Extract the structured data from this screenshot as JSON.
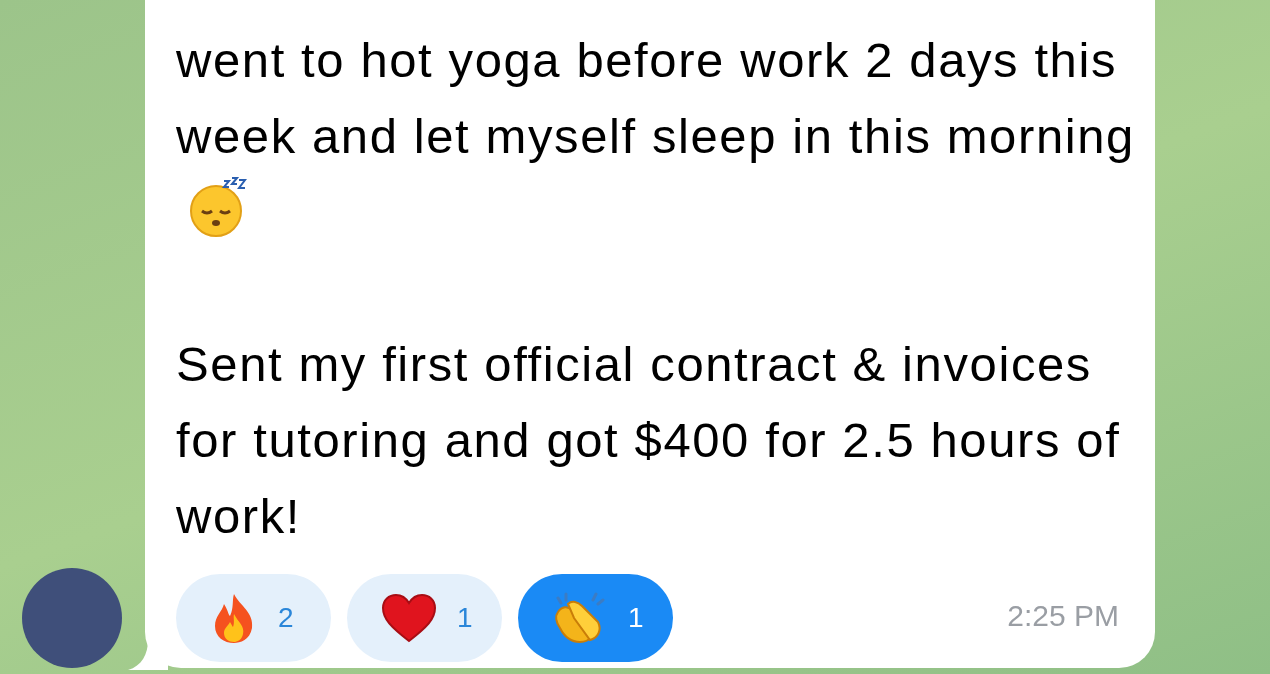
{
  "message": {
    "paragraphs": [
      "went to hot yoga before work 2 days this week and let myself sleep in this morning",
      "Sent my first official contract & invoices for tutoring and got $400 for 2.5 hours of work!"
    ],
    "reactions": [
      {
        "kind": "fire",
        "count": "2",
        "selected": false
      },
      {
        "kind": "heart",
        "count": "1",
        "selected": false
      },
      {
        "kind": "clap",
        "count": "1",
        "selected": true
      }
    ],
    "time": "2:25 PM"
  }
}
